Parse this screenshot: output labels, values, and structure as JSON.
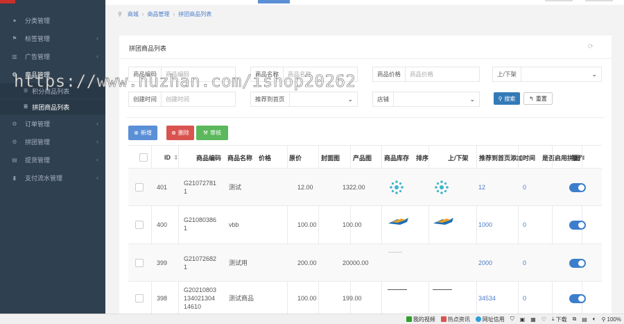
{
  "sidebar": {
    "items": [
      {
        "label": "分类管理",
        "icon": "circle-icon",
        "chevron": ""
      },
      {
        "label": "标签管理",
        "icon": "flag-icon",
        "chevron": "‹"
      },
      {
        "label": "广告管理",
        "icon": "bank-icon",
        "chevron": "‹"
      },
      {
        "label": "商品管理",
        "icon": "gear-icon",
        "chevron": ""
      },
      {
        "label": "积分商品列表",
        "icon": "list-icon"
      },
      {
        "label": "拼团商品列表",
        "icon": "list-icon"
      },
      {
        "label": "订单管理",
        "icon": "gear-icon",
        "chevron": "‹"
      },
      {
        "label": "拼团管理",
        "icon": "gear-icon",
        "chevron": "‹"
      },
      {
        "label": "提货管理",
        "icon": "box-icon",
        "chevron": "‹"
      },
      {
        "label": "支付流水管理",
        "icon": "file-icon",
        "chevron": "‹"
      }
    ]
  },
  "breadcrumb": [
    "商城",
    "商品管理",
    "拼团商品列表"
  ],
  "card": {
    "title": "拼团商品列表"
  },
  "filters": {
    "code_label": "商品编码",
    "code_placeholder": "商品编码",
    "name_label": "商品名称",
    "name_placeholder": "商品名称",
    "price_label": "商品价格",
    "price_placeholder": "商品价格",
    "shelf_label": "上/下架",
    "created_label": "创建时间",
    "created_placeholder": "创建时间",
    "recommend_label": "推荐到首页",
    "store_label": "店铺",
    "search_btn": "搜索",
    "reset_btn": "重置"
  },
  "actions": {
    "add": "新增",
    "delete": "删除",
    "audit": "审核"
  },
  "table": {
    "headers": [
      "ID",
      "商品编码",
      "商品名称",
      "价格",
      "原价",
      "封面图",
      "产品图",
      "商品库存",
      "排序",
      "上/下架",
      "推荐到首页",
      "添加时间",
      "是否启用拼团",
      "操作"
    ],
    "rows": [
      {
        "id": "401",
        "code": [
          "G21072781",
          "1"
        ],
        "name": "测试",
        "orig": "12.00",
        "prod": "1322.00",
        "cover": "snowflake",
        "product": "snowflake",
        "sort": "12",
        "recommend": "0"
      },
      {
        "id": "400",
        "code": [
          "G21080386",
          "1"
        ],
        "name": "vbb",
        "orig": "100.00",
        "prod": "100.00",
        "cover": "bird",
        "product": "bird",
        "sort": "1000",
        "recommend": "0"
      },
      {
        "id": "399",
        "code": [
          "G21072682",
          "1"
        ],
        "name": "测试用",
        "orig": "200.00",
        "prod": "20000.00",
        "cover": "line",
        "product": "",
        "sort": "2000",
        "recommend": "0"
      },
      {
        "id": "398",
        "code": [
          "G20210803",
          "134021304",
          "14610"
        ],
        "name": "测试商品",
        "orig": "100.00",
        "prod": "199.00",
        "cover": "line",
        "product": "line",
        "sort": "34534",
        "recommend": "0"
      }
    ]
  },
  "watermark": "https://www.huzhan.com/ishop20262",
  "statusbar": [
    "我的视频",
    "热点资讯",
    "网址信用",
    "下载",
    "100%"
  ]
}
